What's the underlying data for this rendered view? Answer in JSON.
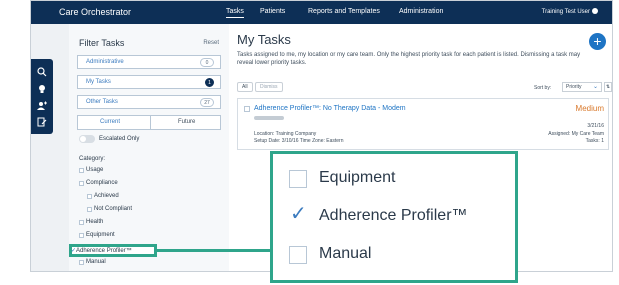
{
  "app": {
    "brand": "Care Orchestrator",
    "nav": [
      "Tasks",
      "Patients",
      "Reports and Templates",
      "Administration"
    ],
    "user": "Training Test User"
  },
  "filter": {
    "title": "Filter Tasks",
    "reset": "Reset",
    "rows": [
      {
        "label": "Administrative",
        "count": "0"
      },
      {
        "label": "My Tasks",
        "count": "1"
      },
      {
        "label": "Other Tasks",
        "count": "27"
      }
    ],
    "segments": [
      "Current",
      "Future"
    ],
    "escalated_label": "Escalated Only",
    "category_label": "Category:",
    "categories": [
      "Usage",
      "Compliance",
      "Achieved",
      "Not Compliant",
      "Health",
      "Equipment",
      "Adherence Profiler™",
      "Manual"
    ]
  },
  "main": {
    "title": "My Tasks",
    "add": "+",
    "intro": "Tasks assigned to me, my location or my care team. Only the highest priority task for each patient is listed. Dismissing a task may reveal lower priority tasks.",
    "select_all": "All",
    "dismiss": "Dismiss",
    "sort_label": "Sort by:",
    "sort_value": "Priority",
    "task": {
      "name": "Adherence Profiler™: No Therapy Data - Modem",
      "priority": "Medium",
      "location": "Location: Training Company",
      "setup": "Setup Date: 3/10/16   Time Zone: Eastern",
      "date": "3/21/16",
      "assigned": "Assigned: My Care Team",
      "tasks": "Tasks: 1"
    }
  },
  "zoom": {
    "items": [
      {
        "label": "Equipment",
        "checked": false
      },
      {
        "label": "Adherence Profiler™",
        "checked": true
      },
      {
        "label": "Manual",
        "checked": false
      }
    ]
  },
  "colors": {
    "nav_bg": "#0d2f56",
    "accent": "#1e74c4",
    "highlight": "#2fa58b",
    "priority_medium": "#d9782a"
  }
}
